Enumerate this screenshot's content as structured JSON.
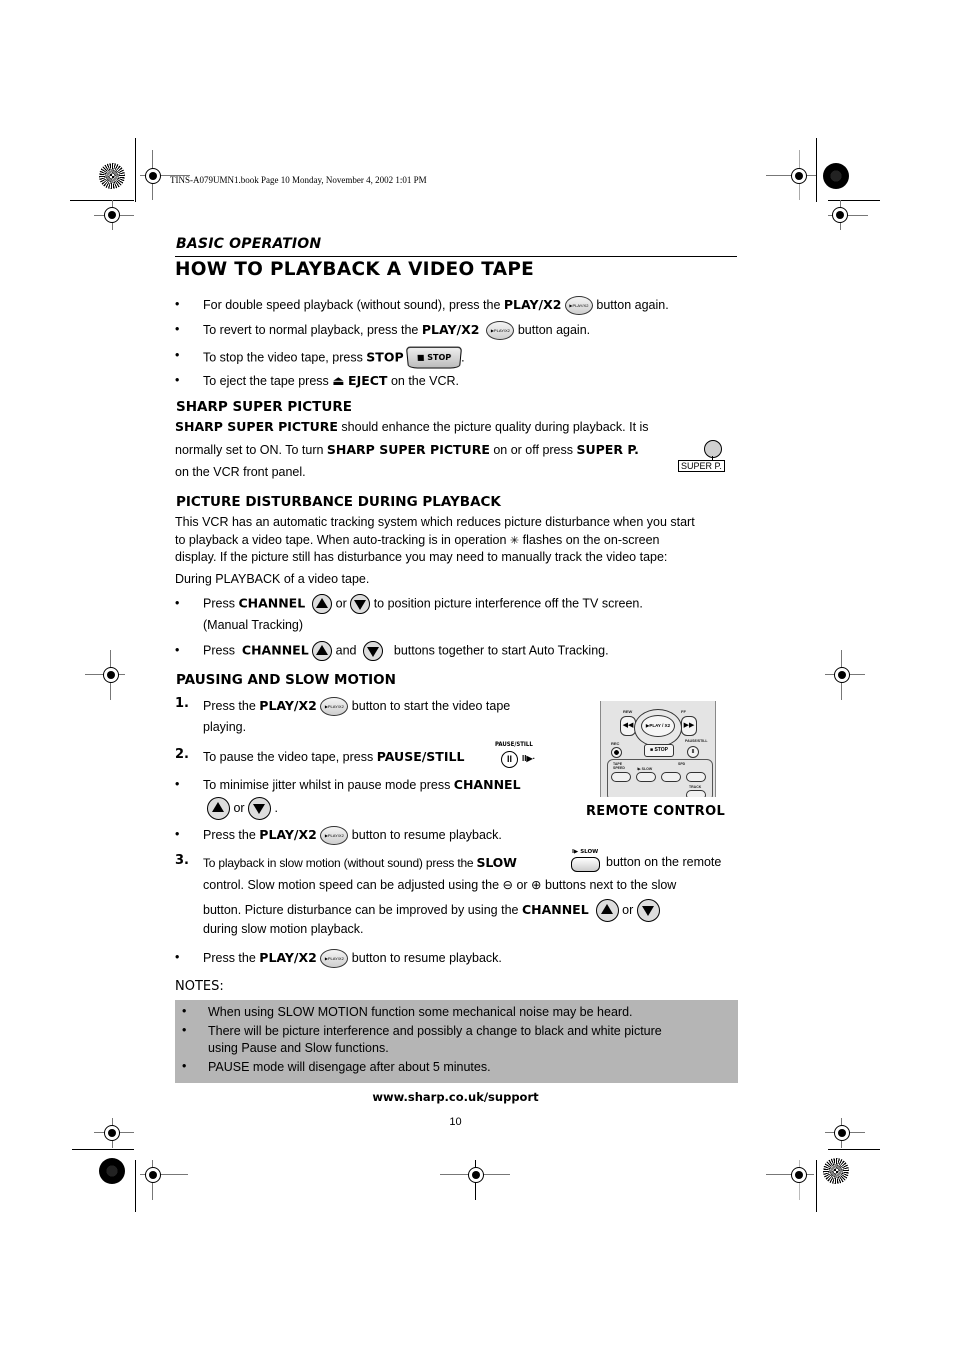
{
  "print_header": {
    "file_info": "TINS-A079UMN1.book  Page 10  Monday, November 4, 2002  1:01 PM"
  },
  "section": "BASIC OPERATION",
  "title": "HOW TO PLAYBACK A VIDEO TAPE",
  "intro_bullets": [
    {
      "pre": "For double speed playback (without sound), press the ",
      "key": "PLAY/X2",
      "icon": "play-x2-button-icon",
      "post": " button again."
    },
    {
      "pre": "To revert to normal playback, press the ",
      "key": "PLAY/X2",
      "icon": "play-x2-button-icon",
      "post": " button again."
    },
    {
      "pre": "To stop the video tape, press ",
      "key": "STOP",
      "icon": "stop-button-icon",
      "post": "."
    },
    {
      "pre": "To eject the tape press ",
      "key": "EJECT",
      "icon": "eject-icon",
      "post": " on the VCR."
    }
  ],
  "icons": {
    "bullet": "•",
    "play_x2_label": "▶PLAY/X2",
    "stop_label": "■ STOP",
    "eject_glyph": "⏏",
    "super_p_label": "SUPER P.",
    "pause_still_label": "PAUSE/STILL",
    "slow_label": "I▶ SLOW",
    "minus_glyph": "⊖",
    "plus_glyph": "⊕",
    "tracking_glyph": "✳"
  },
  "sharp_super_picture": {
    "heading": "SHARP SUPER PICTURE",
    "line1_bold": "SHARP SUPER PICTURE",
    "line1_rest": " should enhance the picture quality during playback. It is",
    "line2_pre": "normally set to ON. To turn ",
    "line2_bold": "SHARP SUPER PICTURE",
    "line2_mid": " on or off press ",
    "line2_key": "SUPER P.",
    "line3": "on the VCR front panel."
  },
  "picture_disturbance": {
    "heading": "PICTURE DISTURBANCE DURING PLAYBACK",
    "line1": "This VCR has an automatic tracking system which reduces picture disturbance when you start",
    "line2_pre": "to playback a video tape. When auto-tracking is in operation ",
    "line2_post": " flashes on the on-screen",
    "line3": "display. If the picture still has disturbance you may need to manually track the video tape:",
    "line4": "During PLAYBACK of a video tape.",
    "bullet1_pre": "Press ",
    "bullet1_key": "CHANNEL",
    "bullet1_or": " or ",
    "bullet1_post": " to position picture interference off the TV screen.",
    "bullet1_line2": "(Manual Tracking)",
    "bullet2_pre": "Press ",
    "bullet2_key": "CHANNEL",
    "bullet2_and": " and ",
    "bullet2_post": " buttons together to start Auto Tracking."
  },
  "pausing": {
    "heading": "PAUSING AND SLOW MOTION",
    "step1_num": "1.",
    "step1_pre": "Press the ",
    "step1_key": "PLAY/X2",
    "step1_post": " button to start the video tape",
    "step1_line2": "playing.",
    "step2_num": "2.",
    "step2_pre": "To pause the video tape, press ",
    "step2_key": "PAUSE/STILL",
    "jitter_pre": "To minimise jitter whilst in pause mode press ",
    "jitter_key": "CHANNEL",
    "jitter_or": " or ",
    "jitter_end": ".",
    "resume1_pre": "Press the ",
    "resume1_key": "PLAY/X2",
    "resume1_post": " button to resume playback.",
    "step3_num": "3.",
    "step3_pre": "To playback in slow motion (without sound) press the ",
    "step3_key": "SLOW",
    "step3_post": " button on the remote",
    "step3_line2_pre": "control. Slow motion speed can be adjusted using the ",
    "step3_line2_or": " or ",
    "step3_line2_post": " buttons next to the slow",
    "step3_line3_pre": "button. Picture disturbance can be improved by using the ",
    "step3_line3_key": "CHANNEL",
    "step3_line3_or": " or ",
    "step3_line4": "during slow motion playback.",
    "resume2_pre": "Press the ",
    "resume2_key": "PLAY/X2",
    "resume2_post": " button to resume playback.",
    "remote_caption": "REMOTE CONTROL",
    "remote_labels": {
      "rew": "REW",
      "ff": "FF",
      "play": "▶PLAY / X2",
      "stop": "■ STOP",
      "rec": "REC",
      "pause": "PAUSE/STILL",
      "tape_speed": "TAPE SPEED",
      "slow": "I▶ SLOW",
      "spd": "SPD",
      "track": "TRACK"
    }
  },
  "notes": {
    "heading": "NOTES:",
    "items": [
      "When using SLOW MOTION function some mechanical noise may be heard.",
      "There will be picture interference and possibly a change to black and white picture",
      "using Pause and Slow functions.",
      "PAUSE mode will disengage after about 5 minutes."
    ]
  },
  "footer": {
    "url": "www.sharp.co.uk/support",
    "page_number": "10"
  }
}
